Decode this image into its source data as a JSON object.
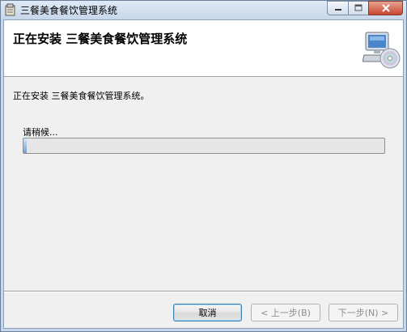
{
  "window": {
    "title": "三餐美食餐饮管理系统"
  },
  "banner": {
    "title": "正在安装 三餐美食餐饮管理系统",
    "icon": "computer-cd-icon"
  },
  "body": {
    "message": "正在安装 三餐美食餐饮管理系统。",
    "wait_label": "请稍候...",
    "progress": 0.01
  },
  "buttons": {
    "cancel": "取消",
    "back": "< 上一步(B)",
    "next": "下一步(N) >"
  },
  "colors": {
    "titlebar": "#c6d7ea",
    "progress_fill": "#6f9fd4",
    "close_button": "#c7462f"
  }
}
